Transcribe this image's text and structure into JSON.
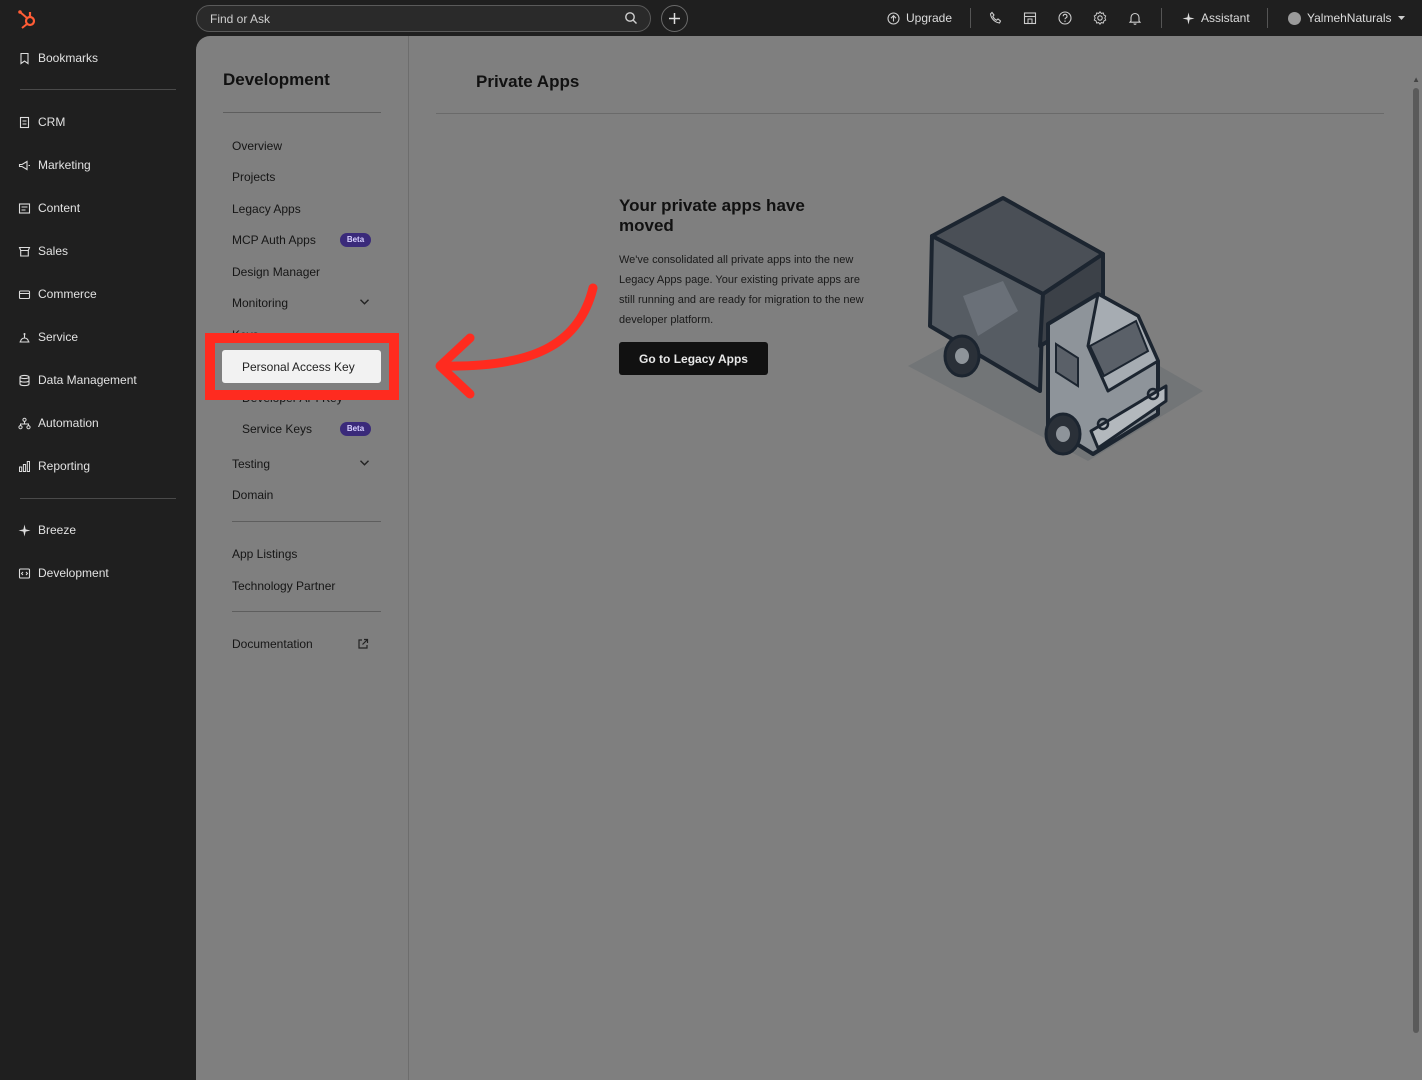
{
  "topbar": {
    "search_placeholder": "Find or Ask",
    "upgrade_label": "Upgrade",
    "assistant_label": "Assistant",
    "account_name": "YalmehNaturals"
  },
  "leftnav": {
    "bookmarks": "Bookmarks",
    "items": [
      "CRM",
      "Marketing",
      "Content",
      "Sales",
      "Commerce",
      "Service",
      "Data Management",
      "Automation",
      "Reporting"
    ],
    "breeze": "Breeze",
    "development": "Development"
  },
  "subnav": {
    "title": "Development",
    "items": [
      "Overview",
      "Projects",
      "Legacy Apps",
      "MCP Auth Apps",
      "Design Manager",
      "Monitoring"
    ],
    "keys_group_partial": "Keys",
    "developer_api_key": "Developer API Key",
    "service_keys": "Service Keys",
    "testing": "Testing",
    "domain": "Domain",
    "app_listings": "App Listings",
    "technology_partner": "Technology Partner",
    "documentation": "Documentation",
    "beta_badge": "Beta"
  },
  "main": {
    "title": "Private Apps",
    "moved_title": "Your private apps have moved",
    "moved_body": "We've consolidated all private apps into the new Legacy Apps page. Your existing private apps are still running and are ready for migration to the new developer platform.",
    "legacy_button": "Go to Legacy Apps"
  },
  "callout": {
    "label": "Personal Access Key",
    "color": "#ff2b1f"
  }
}
